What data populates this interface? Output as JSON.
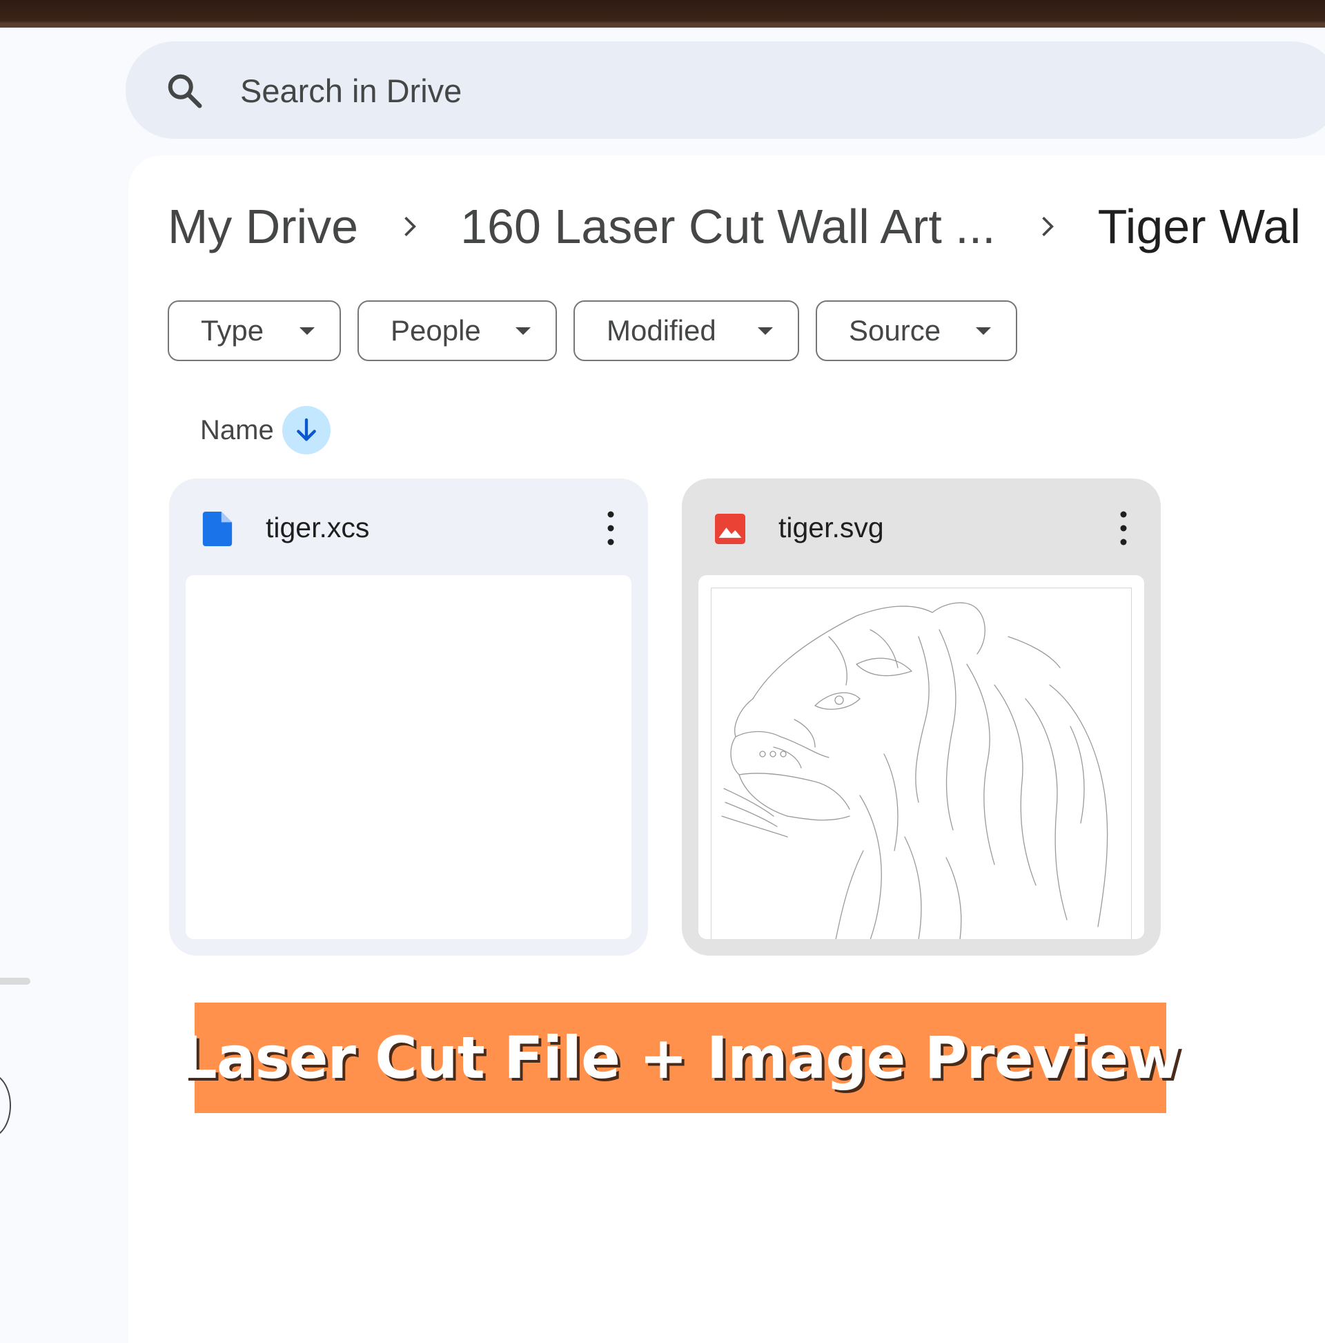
{
  "search": {
    "placeholder": "Search in Drive",
    "icon": "search-icon"
  },
  "breadcrumb": {
    "items": [
      {
        "label": "My Drive"
      },
      {
        "label": "160 Laser Cut Wall Art ..."
      },
      {
        "label": "Tiger Wal"
      }
    ],
    "separator_icon": "chevron-right-icon"
  },
  "filters": [
    {
      "label": "Type"
    },
    {
      "label": "People"
    },
    {
      "label": "Modified"
    },
    {
      "label": "Source"
    }
  ],
  "sort": {
    "label": "Name",
    "direction": "descending",
    "icon": "arrow-down-icon"
  },
  "files": [
    {
      "name": "tiger.xcs",
      "icon": "document-icon",
      "icon_color": "#1a73e8",
      "thumbnail": "blank"
    },
    {
      "name": "tiger.svg",
      "icon": "image-icon",
      "icon_color": "#ea4335",
      "thumbnail": "tiger line drawing"
    }
  ],
  "banner": {
    "text": "Laser Cut File + Image Preview",
    "color": "#ff914d"
  },
  "colors": {
    "accent": "#c2e7ff",
    "search_bg": "#e9eef6"
  }
}
